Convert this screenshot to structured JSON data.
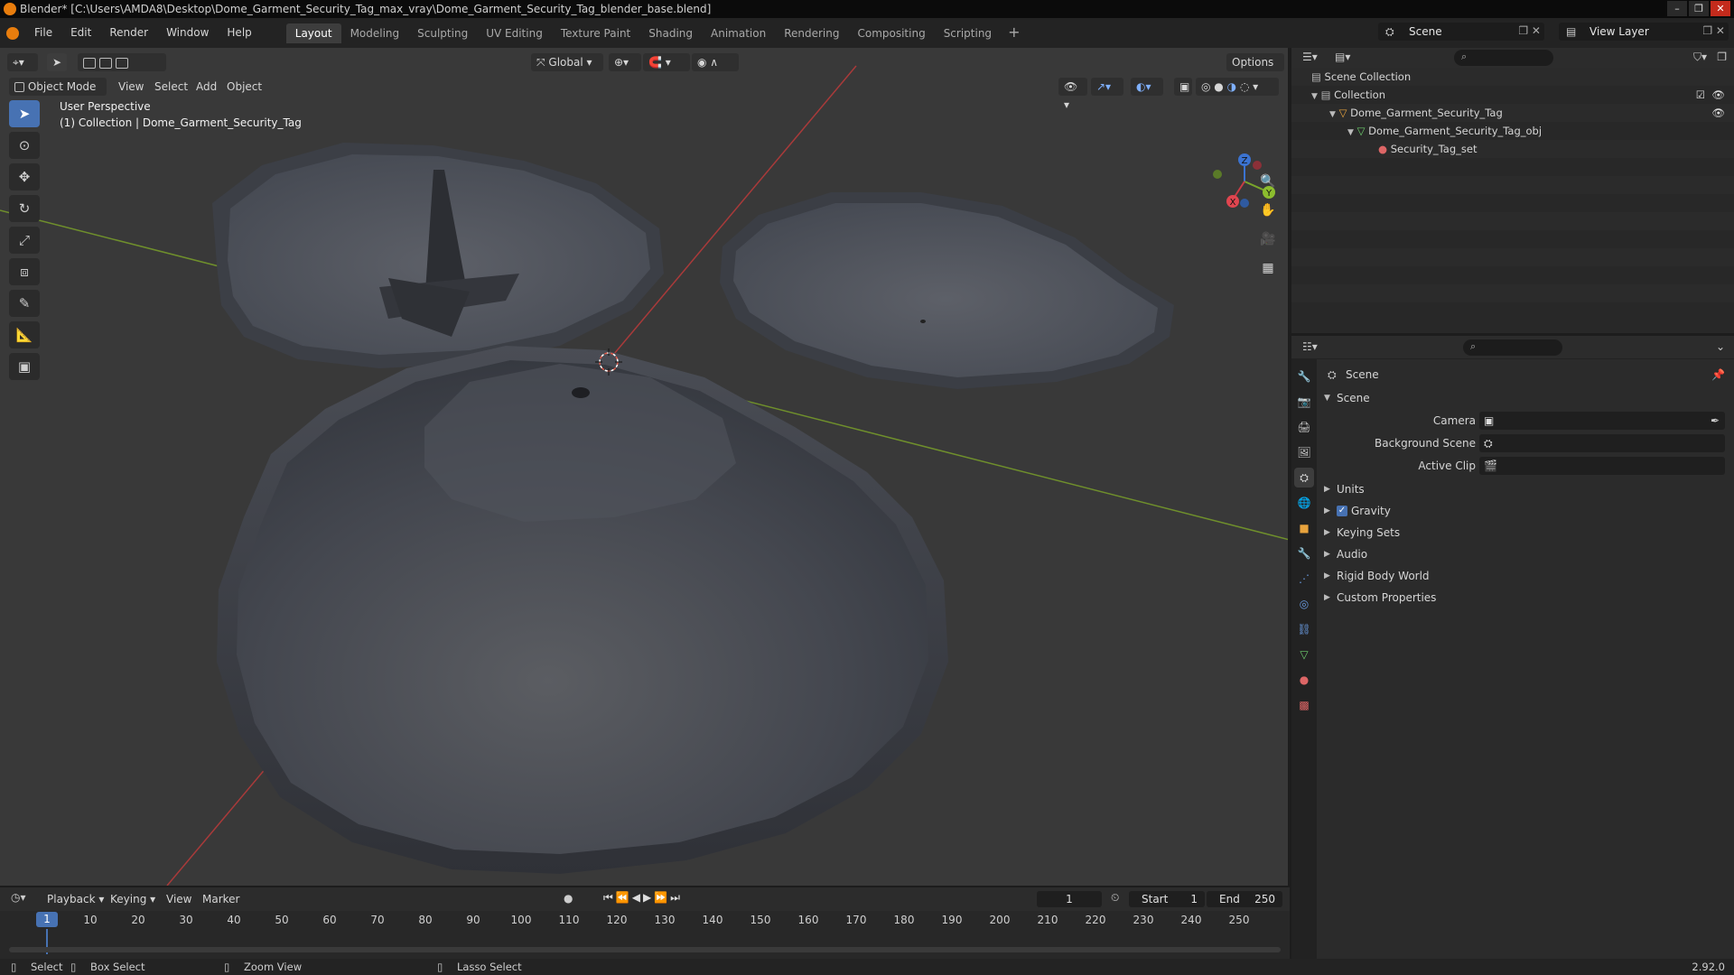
{
  "window": {
    "title": "Blender* [C:\\Users\\AMDA8\\Desktop\\Dome_Garment_Security_Tag_max_vray\\Dome_Garment_Security_Tag_blender_base.blend]",
    "controls": [
      "–",
      "❐",
      "✕"
    ]
  },
  "menubar": {
    "items": [
      "File",
      "Edit",
      "Render",
      "Window",
      "Help"
    ],
    "workspaces": [
      "Layout",
      "Modeling",
      "Sculpting",
      "UV Editing",
      "Texture Paint",
      "Shading",
      "Animation",
      "Rendering",
      "Compositing",
      "Scripting"
    ],
    "active_workspace": "Layout",
    "add_tab": "+",
    "scene": "Scene",
    "view_layer": "View Layer"
  },
  "viewport": {
    "mode": "Object Mode",
    "menus": [
      "View",
      "Select",
      "Add",
      "Object"
    ],
    "transform_orientation": "Global",
    "options": "Options",
    "info_line1": "User Perspective",
    "info_line2": "(1) Collection | Dome_Garment_Security_Tag",
    "tools": [
      "select-box",
      "cursor",
      "move",
      "rotate",
      "scale",
      "transform",
      "annotate",
      "measure",
      "add-cube"
    ],
    "gizmo_axes": [
      "X",
      "Y",
      "Z"
    ]
  },
  "outliner": {
    "rows": [
      {
        "label": "Scene Collection",
        "icon": "scene-collection-icon"
      },
      {
        "label": "Collection",
        "icon": "collection-icon"
      },
      {
        "label": "Dome_Garment_Security_Tag",
        "icon": "object-icon"
      },
      {
        "label": "Dome_Garment_Security_Tag_obj",
        "icon": "mesh-icon"
      },
      {
        "label": "Security_Tag_set",
        "icon": "material-icon"
      }
    ]
  },
  "properties": {
    "context": "Scene",
    "panel": "Scene",
    "fields": [
      {
        "label": "Camera"
      },
      {
        "label": "Background Scene"
      },
      {
        "label": "Active Clip"
      }
    ],
    "subpanels": [
      "Units",
      "Gravity",
      "Keying Sets",
      "Audio",
      "Rigid Body World",
      "Custom Properties"
    ],
    "gravity_checked": true
  },
  "timeline": {
    "menus": [
      "Playback",
      "Keying",
      "View",
      "Marker"
    ],
    "current_frame": "1",
    "start_label": "Start",
    "start": "1",
    "end_label": "End",
    "end": "250",
    "ticks": [
      "10",
      "20",
      "30",
      "40",
      "50",
      "60",
      "70",
      "80",
      "90",
      "100",
      "110",
      "120",
      "130",
      "140",
      "150",
      "160",
      "170",
      "180",
      "190",
      "200",
      "210",
      "220",
      "230",
      "240",
      "250"
    ],
    "cursor_label": "1"
  },
  "statusbar": {
    "select": "Select",
    "box_select": "Box Select",
    "zoom_view": "Zoom View",
    "lasso_select": "Lasso Select",
    "version": "2.92.0"
  }
}
